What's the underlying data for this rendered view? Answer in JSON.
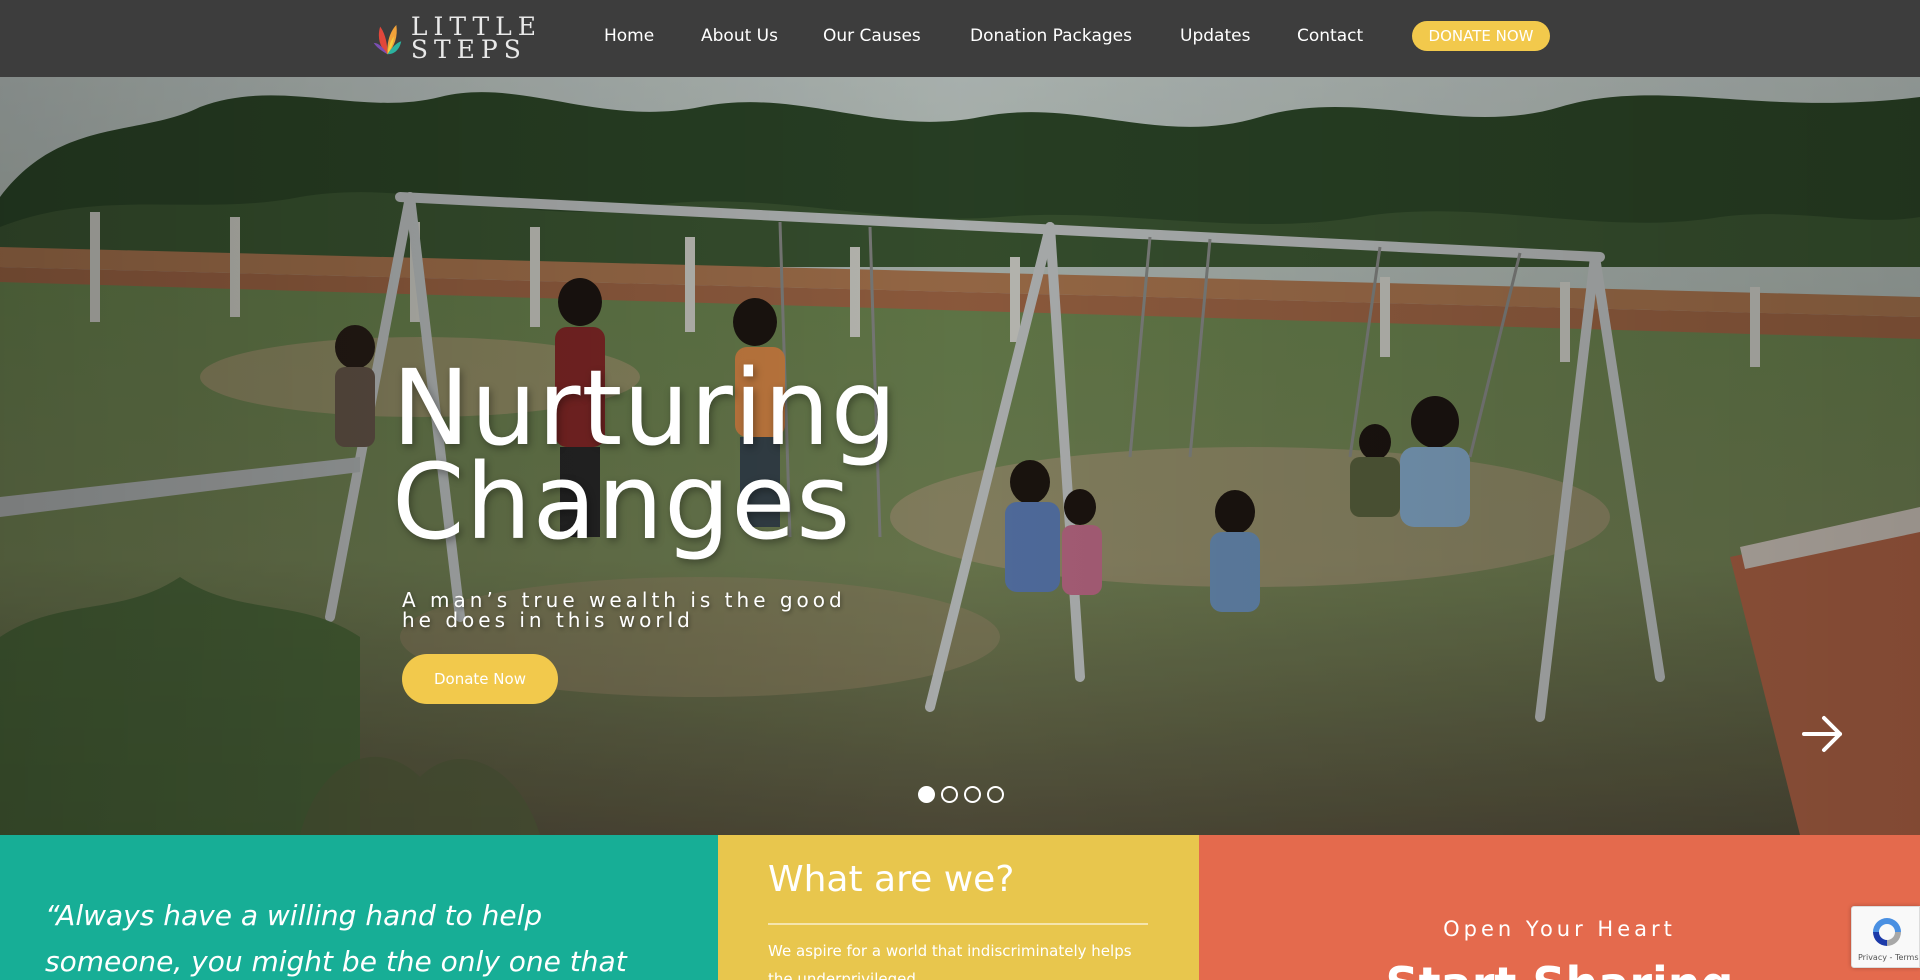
{
  "header": {
    "logo_line1": "LITTLE",
    "logo_line2": "STEPS",
    "nav": [
      "Home",
      "About Us",
      "Our Causes",
      "Donation Packages",
      "Updates",
      "Contact"
    ],
    "donate_label": "DONATE NOW"
  },
  "hero": {
    "title_line1": "Nurturing",
    "title_line2": "Changes",
    "subtitle": "A man’s true wealth is the good he does in this world",
    "button_label": "Donate Now",
    "slide_count": 4,
    "active_slide": 1
  },
  "panels": {
    "quote": "“Always have a willing hand to help someone, you might be the only one that",
    "what_title": "What are we?",
    "what_text": "We aspire for a world that indiscriminately helps the underprivileged",
    "open_heart": "Open Your Heart",
    "red_heading": "Start Sharing"
  },
  "recaptcha": {
    "links": "Privacy - Terms"
  },
  "colors": {
    "accent": "#f2c94c",
    "nav_bg": "#3d3d3d",
    "teal": "#17ae96",
    "yellow": "#e8c64d",
    "red": "#e46a4d"
  }
}
